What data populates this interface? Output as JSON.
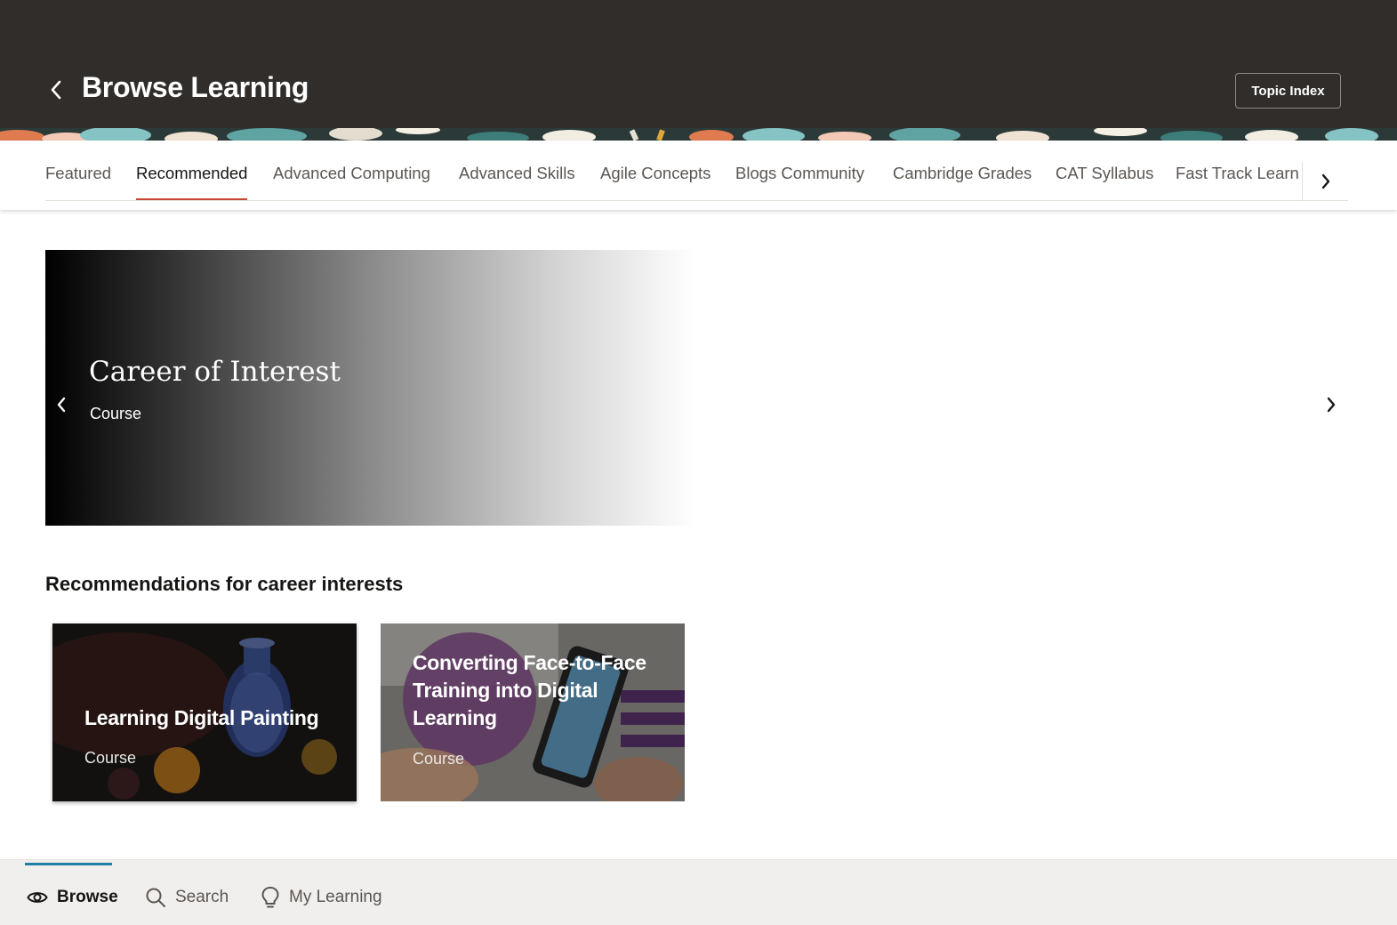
{
  "header": {
    "title": "Browse Learning",
    "topic_index_label": "Topic Index"
  },
  "tabs": [
    {
      "label": "Featured",
      "active": false
    },
    {
      "label": "Recommended",
      "active": true
    },
    {
      "label": "Advanced Computing",
      "active": false
    },
    {
      "label": "Advanced Skills",
      "active": false
    },
    {
      "label": "Agile Concepts",
      "active": false
    },
    {
      "label": "Blogs Community",
      "active": false
    },
    {
      "label": "Cambridge Grades",
      "active": false
    },
    {
      "label": "CAT Syllabus",
      "active": false
    },
    {
      "label": "Fast Track Learn",
      "active": false
    }
  ],
  "hero": {
    "title": "Career of Interest",
    "type": "Course"
  },
  "section": {
    "title": "Recommendations for career interests"
  },
  "cards": [
    {
      "title": "Learning Digital Painting",
      "type": "Course"
    },
    {
      "title_lines": [
        "Converting Face-to-Face",
        "Training into Digital",
        "Learning"
      ],
      "type": "Course"
    }
  ],
  "bottom_nav": [
    {
      "label": "Browse",
      "icon": "eye-icon",
      "active": true
    },
    {
      "label": "Search",
      "icon": "search-icon",
      "active": false
    },
    {
      "label": "My Learning",
      "icon": "lightbulb-icon",
      "active": false
    }
  ],
  "colors": {
    "header_bg": "#312d2a",
    "active_tab_underline": "#c74634",
    "bottom_nav_indicator": "#227e9e"
  }
}
